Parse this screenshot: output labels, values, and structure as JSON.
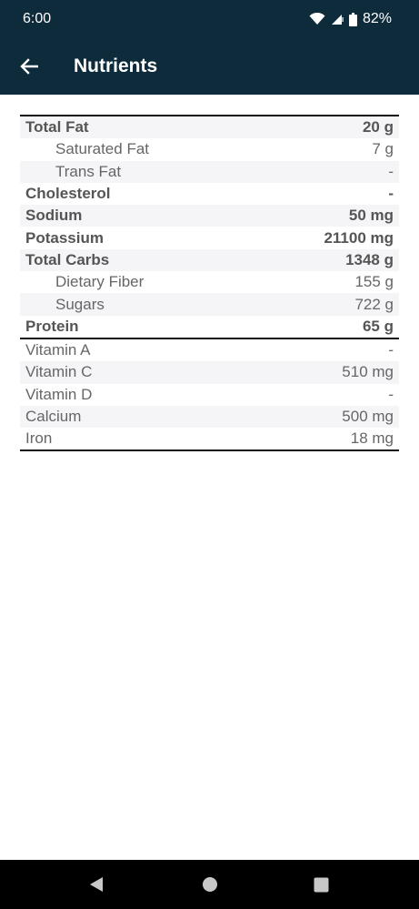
{
  "status": {
    "time": "6:00",
    "battery": "82%"
  },
  "header": {
    "title": "Nutrients"
  },
  "nutrients": [
    {
      "label": "Total Fat",
      "value": "20 g",
      "bold": true,
      "sub": false
    },
    {
      "label": "Saturated Fat",
      "value": "7 g",
      "bold": false,
      "sub": true
    },
    {
      "label": "Trans Fat",
      "value": "-",
      "bold": false,
      "sub": true
    },
    {
      "label": "Cholesterol",
      "value": "-",
      "bold": true,
      "sub": false
    },
    {
      "label": "Sodium",
      "value": "50 mg",
      "bold": true,
      "sub": false
    },
    {
      "label": "Potassium",
      "value": "21100 mg",
      "bold": true,
      "sub": false
    },
    {
      "label": "Total Carbs",
      "value": "1348 g",
      "bold": true,
      "sub": false
    },
    {
      "label": "Dietary Fiber",
      "value": "155 g",
      "bold": false,
      "sub": true
    },
    {
      "label": "Sugars",
      "value": "722 g",
      "bold": false,
      "sub": true
    },
    {
      "label": "Protein",
      "value": "65 g",
      "bold": true,
      "sub": false
    }
  ],
  "vitamins": [
    {
      "label": "Vitamin A",
      "value": "-"
    },
    {
      "label": "Vitamin C",
      "value": "510 mg"
    },
    {
      "label": "Vitamin D",
      "value": "-"
    },
    {
      "label": "Calcium",
      "value": "500 mg"
    },
    {
      "label": "Iron",
      "value": "18 mg"
    }
  ]
}
